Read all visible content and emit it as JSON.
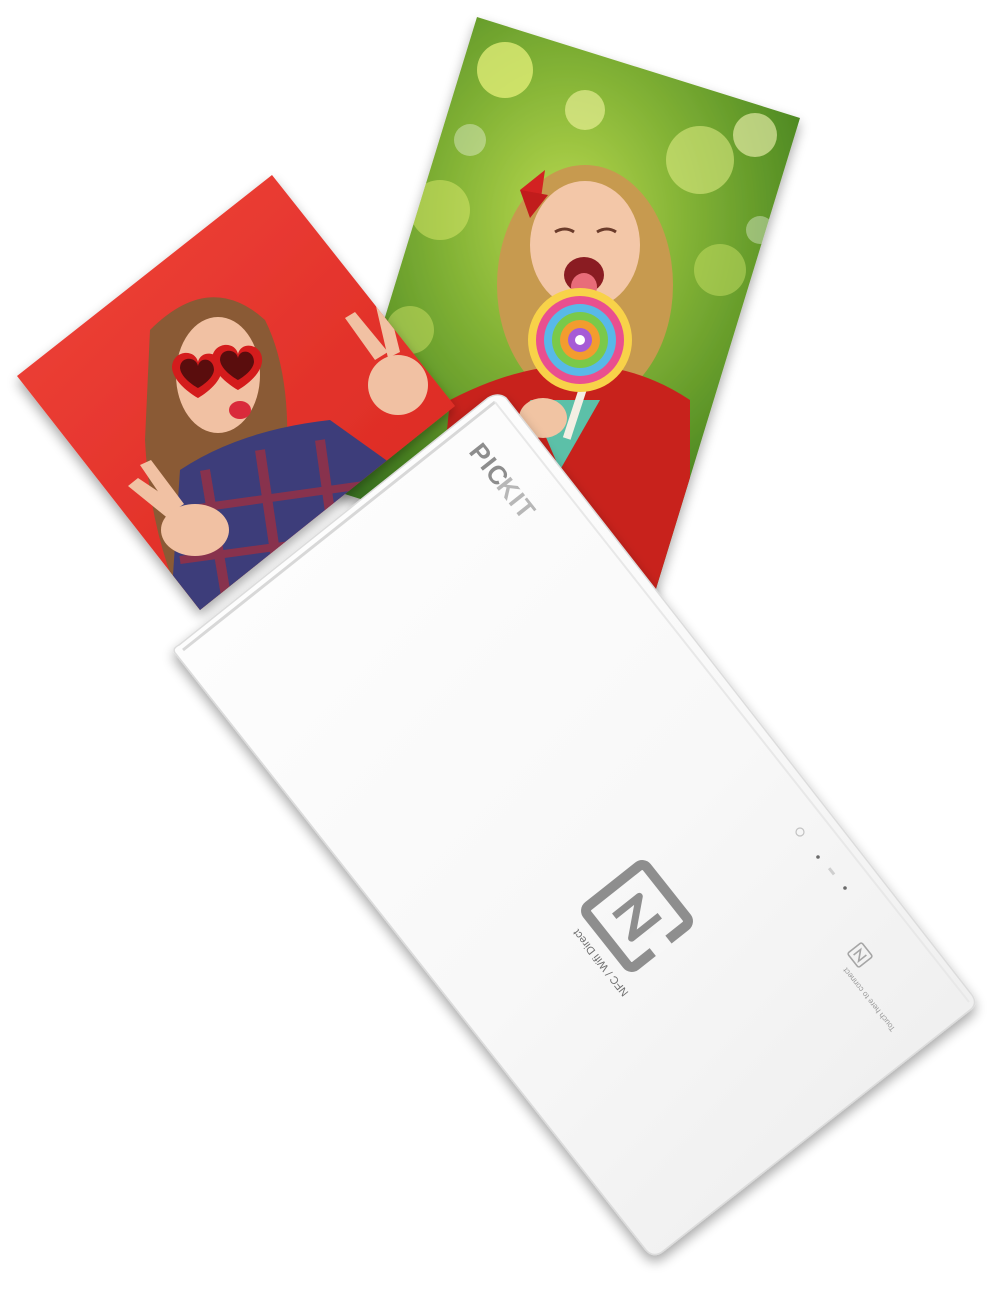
{
  "brand": {
    "name_pic": "PIC",
    "name_kit": "KIT"
  },
  "printer": {
    "nfc_label": "NFC / Wifi Direct",
    "side_label": "Touch here to connect"
  },
  "colors": {
    "red_background": "#e8322c",
    "green_background": "#7fb23c",
    "printer_body": "#ffffff",
    "logo_gray": "#8e8e8e"
  },
  "icons": {
    "nfc_logo": "nfc-n-icon",
    "small_nfc_logo": "small-nfc-icon"
  }
}
